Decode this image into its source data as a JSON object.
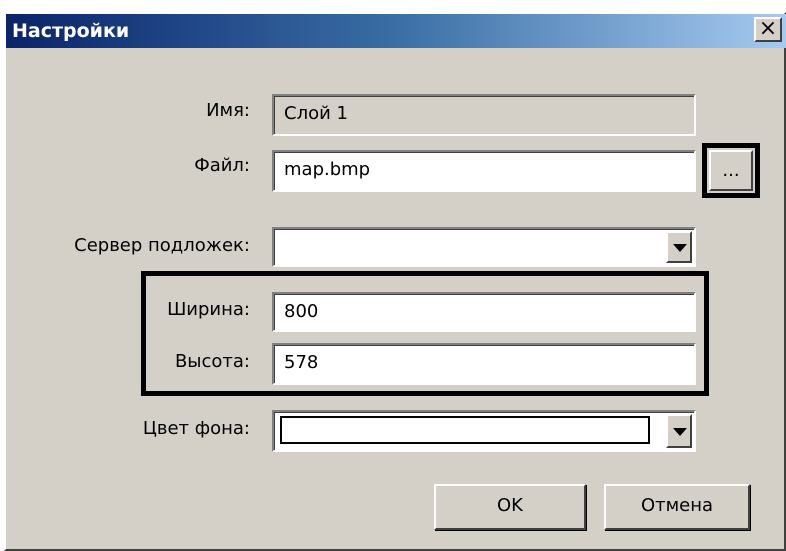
{
  "window": {
    "title": "Настройки",
    "close_glyph": "×"
  },
  "form": {
    "name": {
      "label": "Имя:",
      "value": "Слой 1"
    },
    "file": {
      "label": "Файл:",
      "value": "map.bmp",
      "browse_label": "..."
    },
    "server": {
      "label": "Сервер подложек:",
      "value": ""
    },
    "width": {
      "label": "Ширина:",
      "value": "800"
    },
    "height": {
      "label": "Высота:",
      "value": "578"
    },
    "bg_color": {
      "label": "Цвет фона:",
      "value": ""
    }
  },
  "buttons": {
    "ok": "OK",
    "cancel": "Отмена"
  },
  "colors": {
    "dialog_bg": "#d4d0c8",
    "title_start": "#0a246a",
    "title_end": "#a6caf0",
    "highlight": "#000000"
  },
  "icons": {
    "close": "close-icon",
    "dropdown": "chevron-down-icon"
  }
}
